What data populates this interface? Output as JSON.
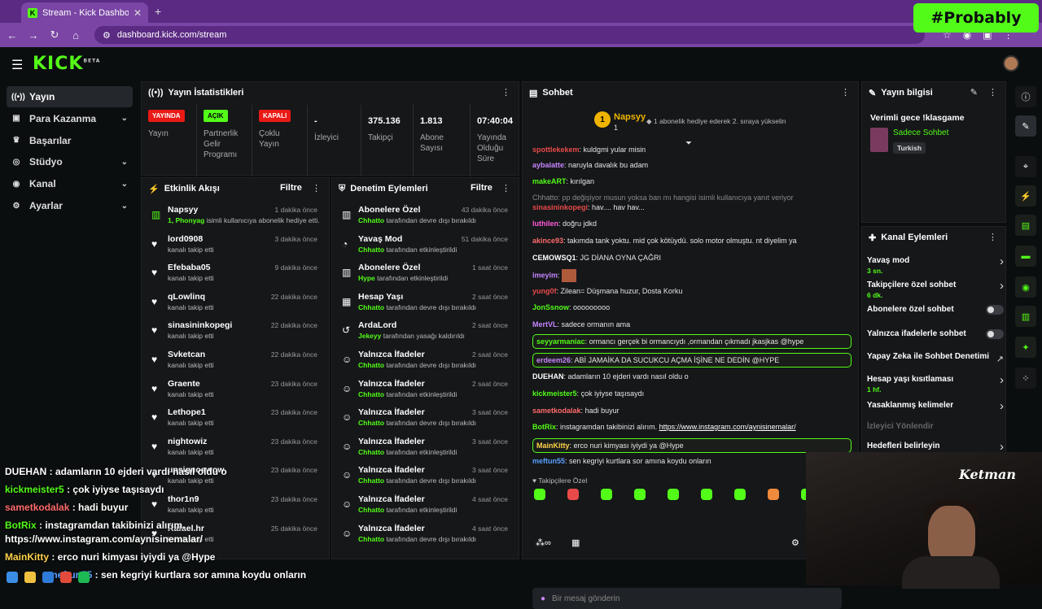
{
  "browser": {
    "tab_title": "Stream - Kick Dashboard",
    "url": "dashboard.kick.com/stream",
    "overlay_badge": "#Probably"
  },
  "app": {
    "logo": "KICK",
    "logo_beta": "BETA"
  },
  "sidebar": {
    "items": [
      {
        "label": "Yayın",
        "icon": "broadcast-icon",
        "active": true,
        "chevron": false
      },
      {
        "label": "Para Kazanma",
        "icon": "money-icon",
        "active": false,
        "chevron": true
      },
      {
        "label": "Başarılar",
        "icon": "trophy-icon",
        "active": false,
        "chevron": false
      },
      {
        "label": "Stüdyo",
        "icon": "studio-icon",
        "active": false,
        "chevron": true
      },
      {
        "label": "Kanal",
        "icon": "channel-icon",
        "active": false,
        "chevron": true
      },
      {
        "label": "Ayarlar",
        "icon": "gear-icon",
        "active": false,
        "chevron": true
      }
    ]
  },
  "stats": {
    "title": "Yayın İstatistikleri",
    "cells": [
      {
        "badge": "YAYINDA",
        "badge_color": "#e91916",
        "label": "Yayın"
      },
      {
        "badge": "AÇIK",
        "badge_color": "#53fc18",
        "label": "Partnerlik Gelir Programı"
      },
      {
        "badge": "KAPALI",
        "badge_color": "#e91916",
        "label": "Çoklu Yayın"
      },
      {
        "value": "-",
        "label": "İzleyici"
      },
      {
        "value": "375.136",
        "label": "Takipçi"
      },
      {
        "value": "1.813",
        "label": "Abone Sayısı"
      },
      {
        "value": "07:40:04",
        "label": "Yayında Olduğu Süre"
      }
    ]
  },
  "activity": {
    "title": "Etkinlik Akışı",
    "filter": "Filtre",
    "items": [
      {
        "name": "Napsyy",
        "time": "1 dakika önce",
        "sub": "isimli kullanıcıya abonelik hediye etti.",
        "sub_prefix": "1, Phonyag",
        "icon": "gift-icon"
      },
      {
        "name": "lord0908",
        "time": "3 dakika önce",
        "sub": "kanalı takip etti",
        "icon": "heart-icon"
      },
      {
        "name": "Efebaba05",
        "time": "9 dakika önce",
        "sub": "kanalı takip etti",
        "icon": "heart-icon"
      },
      {
        "name": "qLowlinq",
        "time": "22 dakika önce",
        "sub": "kanalı takip etti",
        "icon": "heart-icon"
      },
      {
        "name": "sinasininkopegi",
        "time": "22 dakika önce",
        "sub": "kanalı takip etti",
        "icon": "heart-icon"
      },
      {
        "name": "Svketcan",
        "time": "22 dakika önce",
        "sub": "kanalı takip etti",
        "icon": "heart-icon"
      },
      {
        "name": "Graente",
        "time": "23 dakika önce",
        "sub": "kanalı takip etti",
        "icon": "heart-icon"
      },
      {
        "name": "Lethope1",
        "time": "23 dakika önce",
        "sub": "kanalı takip etti",
        "icon": "heart-icon"
      },
      {
        "name": "nightowiz",
        "time": "23 dakika önce",
        "sub": "kanalı takip etti",
        "icon": "heart-icon"
      },
      {
        "name": "upsignoswow",
        "time": "23 dakika önce",
        "sub": "kanalı takip etti",
        "icon": "heart-icon"
      },
      {
        "name": "thor1n9",
        "time": "23 dakika önce",
        "sub": "kanalı takip etti",
        "icon": "heart-icon"
      },
      {
        "name": "Rafael.hr",
        "time": "25 dakika önce",
        "sub": "kanalı takip etti",
        "icon": "heart-icon"
      }
    ]
  },
  "moderation": {
    "title": "Denetim Eylemleri",
    "filter": "Filtre",
    "items": [
      {
        "name": "Abonelere Özel",
        "time": "43 dakika önce",
        "actor": "Chhatto",
        "sub": "tarafından devre dışı bırakıldı",
        "icon": "gift-icon"
      },
      {
        "name": "Yavaş Mod",
        "time": "51 dakika önce",
        "actor": "Chhatto",
        "sub": "tarafından etkinleştirildi",
        "icon": "snail-icon"
      },
      {
        "name": "Abonelere Özel",
        "time": "1 saat önce",
        "actor": "Hype",
        "sub": "tarafından etkinleştirildi",
        "icon": "gift-icon"
      },
      {
        "name": "Hesap Yaşı",
        "time": "2 saat önce",
        "actor": "Chhatto",
        "sub": "tarafından devre dışı bırakıldı",
        "icon": "calendar-icon"
      },
      {
        "name": "ArdaLord",
        "time": "2 saat önce",
        "actor": "Jekeyy",
        "sub": "tarafından yasağı kaldırıldı",
        "icon": "unban-icon"
      },
      {
        "name": "Yalnızca İfadeler",
        "time": "2 saat önce",
        "actor": "Chhatto",
        "sub": "tarafından devre dışı bırakıldı",
        "icon": "emoji-icon"
      },
      {
        "name": "Yalnızca İfadeler",
        "time": "2 saat önce",
        "actor": "Chhatto",
        "sub": "tarafından etkinleştirildi",
        "icon": "emoji-icon"
      },
      {
        "name": "Yalnızca İfadeler",
        "time": "3 saat önce",
        "actor": "Chhatto",
        "sub": "tarafından devre dışı bırakıldı",
        "icon": "emoji-icon"
      },
      {
        "name": "Yalnızca İfadeler",
        "time": "3 saat önce",
        "actor": "Chhatto",
        "sub": "tarafından etkinleştirildi",
        "icon": "emoji-icon"
      },
      {
        "name": "Yalnızca İfadeler",
        "time": "3 saat önce",
        "actor": "Chhatto",
        "sub": "tarafından devre dışı bırakıldı",
        "icon": "emoji-icon"
      },
      {
        "name": "Yalnızca İfadeler",
        "time": "4 saat önce",
        "actor": "Chhatto",
        "sub": "tarafından etkinleştirildi",
        "icon": "emoji-icon"
      },
      {
        "name": "Yalnızca İfadeler",
        "time": "4 saat önce",
        "actor": "Chhatto",
        "sub": "tarafından devre dışı bırakıldı",
        "icon": "emoji-icon"
      }
    ]
  },
  "chat": {
    "title": "Sohbet",
    "pinned_user": "Napsyy",
    "pinned_count": "1",
    "pinned_rank": "1",
    "pinned_note": "1 abonelik hediye ederek 2. sıraya yükselin",
    "messages": [
      {
        "user": "spottlekekem",
        "color": "#e84a4a",
        "text": "kuldgmi yular misin",
        "kind": "normal"
      },
      {
        "user": "aybalatte",
        "color": "#c685ff",
        "text": "naruyla davalık bu adam",
        "kind": "normal"
      },
      {
        "user": "makeART",
        "color": "#53fc18",
        "text": "kırılgan",
        "kind": "normal"
      },
      {
        "user": "",
        "color": "#888888",
        "text": "Chhatto: pp değişiyor musun yoksa ban mı hangisi isimli kullanıcıya yanıt veriyor",
        "kind": "sys"
      },
      {
        "user": "sinasininkopegi",
        "color": "#e84a4a",
        "text": "hav.... hav hav...",
        "kind": "normal"
      },
      {
        "user": "luthilen",
        "color": "#ff5ad8",
        "text": "doğru jdkd",
        "kind": "normal"
      },
      {
        "user": "akince93",
        "color": "#ff6b6b",
        "text": "takımda tank yoktu. mid çok kötüydü. solo motor olmuştu. nt diyelim ya",
        "kind": "normal"
      },
      {
        "user": "CEMOWSQ1",
        "color": "#ffffff",
        "text": "JG DİANA OYNA ÇAĞRI",
        "kind": "normal"
      },
      {
        "user": "imeyim",
        "color": "#c685ff",
        "text": "",
        "kind": "normal"
      },
      {
        "user": "yung0f",
        "color": "#e84a4a",
        "text": "Zilean= Düşmana huzur, Dosta Korku",
        "kind": "normal"
      },
      {
        "user": "JonSsnow",
        "color": "#53fc18",
        "text": "ooooooooo",
        "kind": "normal"
      },
      {
        "user": "MertVL",
        "color": "#c685ff",
        "text": "sadece ormanın ama",
        "kind": "normal"
      },
      {
        "user": "seyyarmaniac",
        "color": "#53fc18",
        "text": "ormancı gerçek bi ormancıydı ,ormandan çıkmadı jkasjkas @hype",
        "kind": "hl"
      },
      {
        "user": "erdeem26",
        "color": "#c685ff",
        "text": "ABİ JAMAİKA DA SUCUKCU AÇMA İŞİNE NE DEDİN @HYPE",
        "kind": "hl"
      },
      {
        "user": "DUEHAN",
        "color": "#ffffff",
        "text": "adamların 10 ejderi vardı nasıl oldu o",
        "kind": "normal"
      },
      {
        "user": "kickmeister5",
        "color": "#53fc18",
        "text": "çok iyiyse taşısaydı",
        "kind": "normal"
      },
      {
        "user": "sametkodalak",
        "color": "#ff6b6b",
        "text": "hadi buyur",
        "kind": "normal"
      },
      {
        "user": "BotRix",
        "color": "#53fc18",
        "text": "instagramdan takibinizi alırım.",
        "link": "https://www.instagram.com/aynisinemalar/",
        "kind": "normal"
      },
      {
        "user": "MainKitty",
        "color": "#ffd24a",
        "text": "erco nuri kimyası iyiydi ya @Hype",
        "kind": "hl"
      },
      {
        "user": "meftun55",
        "color": "#5aa0ff",
        "text": "sen kegriyi kurtlara sor amına koydu onların",
        "kind": "normal"
      }
    ],
    "followers_only_label": "Takipçilere Özel",
    "input_placeholder": "Bir mesaj gönderin"
  },
  "stream_info": {
    "title": "Yayın bilgisi",
    "stream_title": "Verimli gece !klasgame",
    "category": "Sadece Sohbet",
    "language": "Turkish"
  },
  "channel_actions": {
    "title": "Kanal Eylemleri",
    "items": [
      {
        "label": "Yavaş mod",
        "sub": "3 sn.",
        "control": "chevron"
      },
      {
        "label": "Takipçilere özel sohbet",
        "sub": "6 dk.",
        "control": "chevron"
      },
      {
        "label": "Abonelere özel sohbet",
        "sub": "",
        "control": "toggle"
      },
      {
        "label": "Yalnızca ifadelerle sohbet",
        "sub": "",
        "control": "toggle"
      },
      {
        "label": "Yapay Zeka ile Sohbet Denetimi",
        "sub": "",
        "control": "external"
      },
      {
        "label": "Hesap yaşı kısıtlaması",
        "sub": "1 hf.",
        "control": "chevron"
      },
      {
        "label": "Yasaklanmış kelimeler",
        "sub": "",
        "control": "chevron"
      },
      {
        "label": "İzleyici Yönlendir",
        "sub": "",
        "control": "none",
        "disabled": true
      },
      {
        "label": "Hedefleri belirleyin",
        "sub": "",
        "control": "chevron"
      }
    ]
  },
  "overlay_chat": [
    {
      "user": "DUEHAN",
      "text": " : adamların 10 ejderi vardı nasıl oldu o",
      "color": "#ffffff"
    },
    {
      "user": "kickmeister5",
      "text": " : çok iyiyse taşısaydı",
      "color": "#53fc18"
    },
    {
      "user": "sametkodalak",
      "text": " : hadi buyur",
      "color": "#ff6b6b"
    },
    {
      "user": "BotRix",
      "text": " : instagramdan takibinizi alırım.",
      "color": "#53fc18"
    },
    {
      "user": "",
      "text": "https://www.instagram.com/aynisinemalar/",
      "color": "#ffffff"
    },
    {
      "user": "MainKitty",
      "text": " : erco nuri kimyası iyiydi ya @Hype",
      "color": "#ffd24a"
    },
    {
      "user": "meftun55",
      "text": " : sen kegriyi kurtlara sor amına koydu onların",
      "color": "#5aa0ff"
    }
  ],
  "webcam_logo": "Ketman"
}
